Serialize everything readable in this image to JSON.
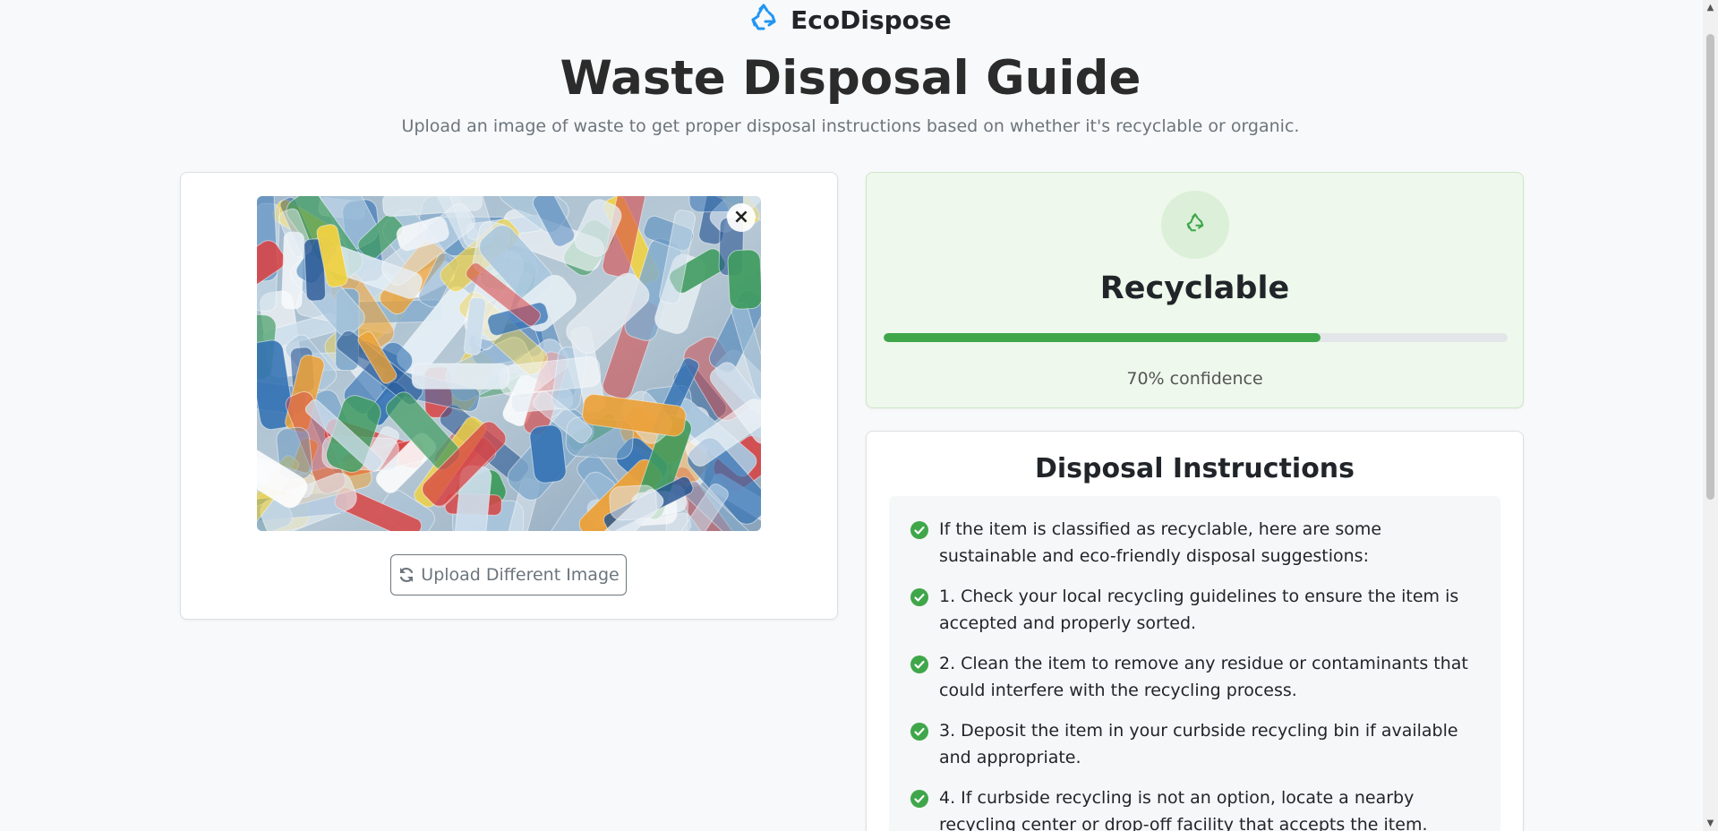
{
  "header": {
    "brand_name": "EcoDispose",
    "brand_icon": "recycle-icon",
    "title": "Waste Disposal Guide",
    "subtitle": "Upload an image of waste to get proper disposal instructions based on whether it's recyclable or organic."
  },
  "upload": {
    "image_alt": "plastic-bottles-photo",
    "close_label": "×",
    "button_label": "Upload Different Image",
    "button_icon": "refresh-icon"
  },
  "result": {
    "icon": "recycle-icon",
    "label": "Recyclable",
    "confidence_fraction": 0.7,
    "confidence_text": "70% confidence",
    "accent_color": "#3fa74a"
  },
  "instructions": {
    "title": "Disposal Instructions",
    "items": [
      "If the item is classified as recyclable, here are some sustainable and eco-friendly disposal suggestions:",
      "1. Check your local recycling guidelines to ensure the item is accepted and properly sorted.",
      "2. Clean the item to remove any residue or contaminants that could interfere with the recycling process.",
      "3. Deposit the item in your curbside recycling bin if available and appropriate.",
      "4. If curbside recycling is not an option, locate a nearby recycling center or drop-off facility that accepts the item."
    ]
  }
}
